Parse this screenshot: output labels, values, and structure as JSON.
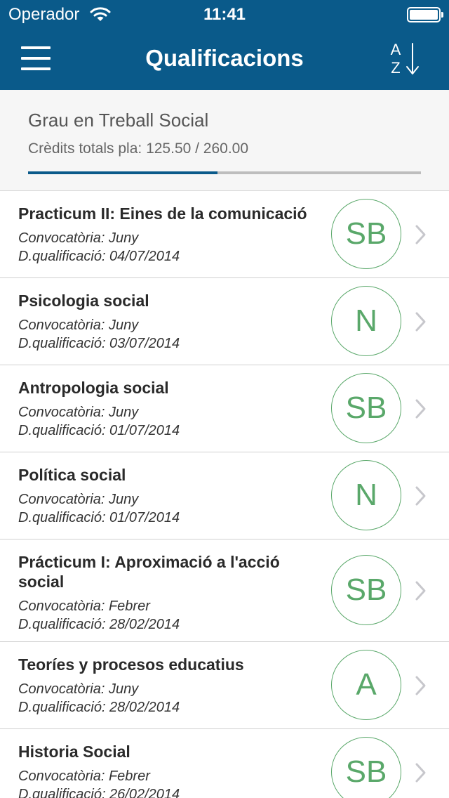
{
  "status_bar": {
    "carrier": "Operador",
    "time": "11:41"
  },
  "nav": {
    "title": "Qualificacions",
    "sort_top": "A",
    "sort_bottom": "Z"
  },
  "summary": {
    "degree": "Grau en Treball Social",
    "credits_label": "Crèdits totals pla: 125.50 / 260.00",
    "credits_done": 125.5,
    "credits_total": 260.0
  },
  "colors": {
    "primary": "#0a5a8a",
    "grade": "#5aa86a"
  },
  "subjects": [
    {
      "name": "Practicum II: Eines de la comunicació",
      "call": "Convocatòria: Juny",
      "date": "D.qualificació: 04/07/2014",
      "grade": "SB"
    },
    {
      "name": "Psicologia social",
      "call": "Convocatòria: Juny",
      "date": "D.qualificació: 03/07/2014",
      "grade": "N"
    },
    {
      "name": "Antropologia social",
      "call": "Convocatòria: Juny",
      "date": "D.qualificació: 01/07/2014",
      "grade": "SB"
    },
    {
      "name": "Política social",
      "call": "Convocatòria: Juny",
      "date": "D.qualificació: 01/07/2014",
      "grade": "N"
    },
    {
      "name": "Prácticum I: Aproximació a l'acció social",
      "call": "Convocatòria: Febrer",
      "date": "D.qualificació: 28/02/2014",
      "grade": "SB"
    },
    {
      "name": "Teoríes y procesos educatius",
      "call": "Convocatòria: Juny",
      "date": "D.qualificació: 28/02/2014",
      "grade": "A"
    },
    {
      "name": "Historia Social",
      "call": "Convocatòria: Febrer",
      "date": "D.qualificació: 26/02/2014",
      "grade": "SB"
    }
  ]
}
